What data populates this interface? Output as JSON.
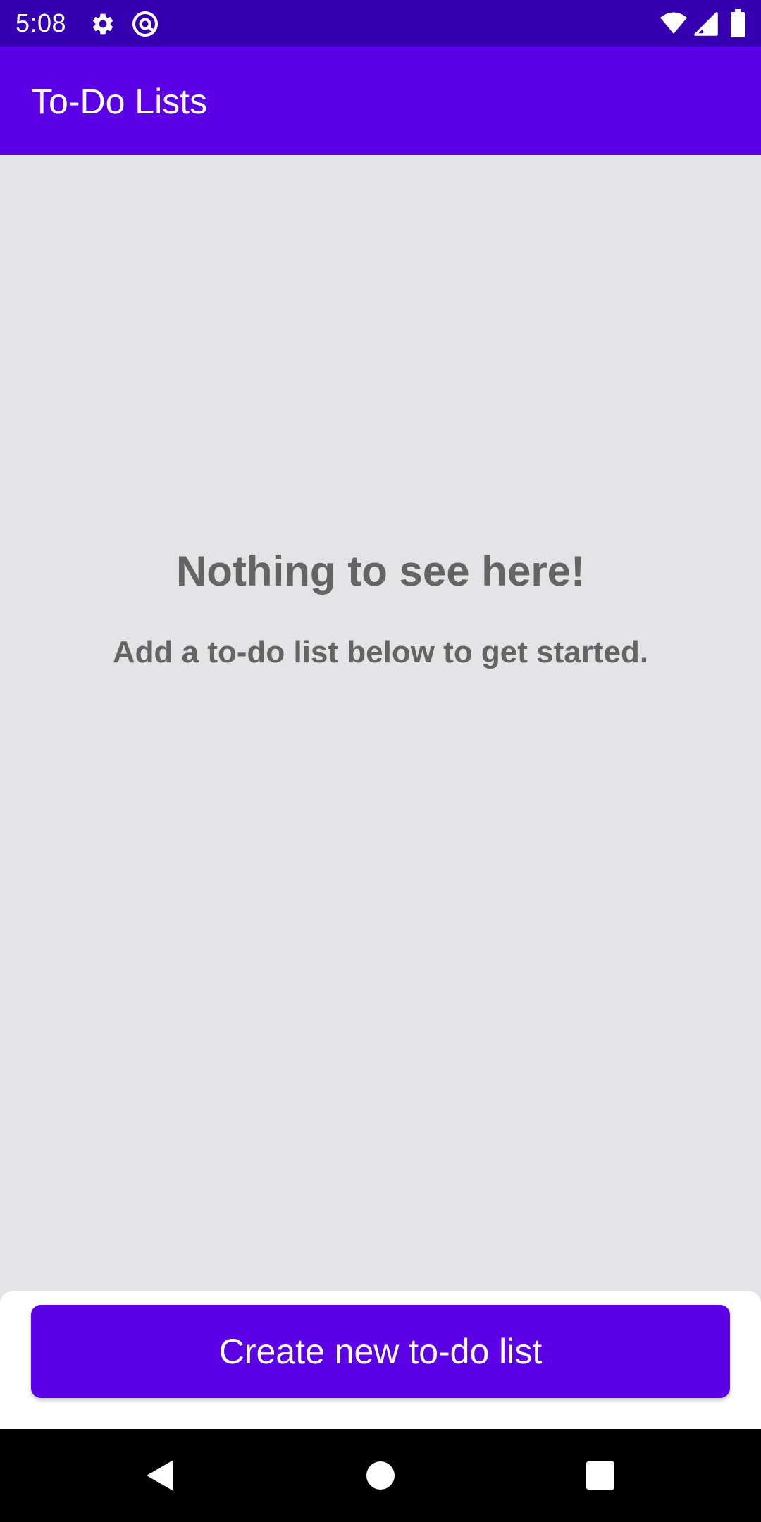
{
  "status_bar": {
    "time": "5:08",
    "left_icons": [
      "gear-icon",
      "at-sign-icon"
    ],
    "right_icons": [
      "wifi-icon",
      "signal-icon",
      "battery-icon"
    ]
  },
  "app_bar": {
    "title": "To-Do Lists"
  },
  "empty_state": {
    "title": "Nothing to see here!",
    "subtitle": "Add a to-do list below to get started."
  },
  "actions": {
    "create_label": "Create new to-do list"
  },
  "nav_bar": {
    "buttons": [
      "back-icon",
      "home-icon",
      "recents-icon"
    ]
  },
  "colors": {
    "status_bar": "#3600b0",
    "app_bar": "#5c00e6",
    "primary_button": "#5c00e6",
    "background": "#e4e3e6",
    "empty_text": "#646464",
    "nav_bar": "#000000"
  }
}
